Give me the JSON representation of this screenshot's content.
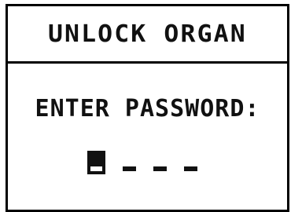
{
  "screen": {
    "title": "UNLOCK ORGAN",
    "prompt": "ENTER PASSWORD:",
    "password": {
      "length": 4,
      "cursor_position": 1,
      "entered_digits": 0
    }
  },
  "colors": {
    "background": "#ffffff",
    "foreground": "#000000"
  }
}
